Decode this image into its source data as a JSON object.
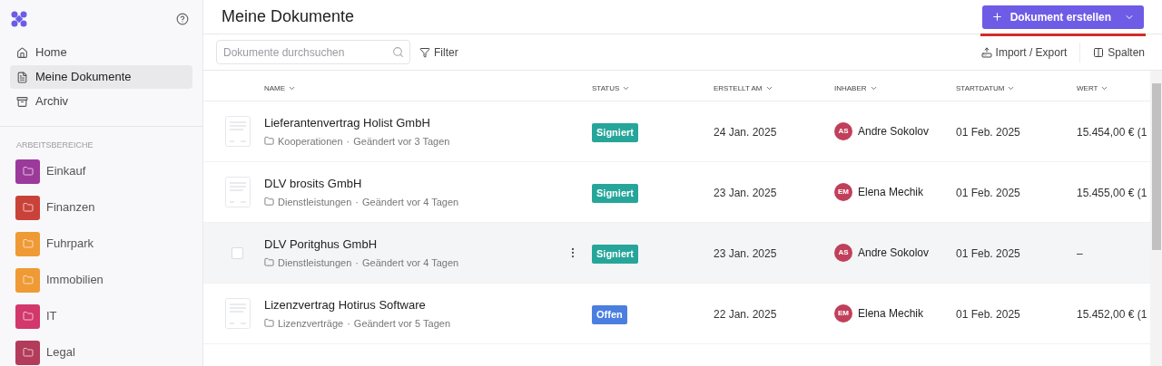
{
  "sidebar": {
    "nav": [
      {
        "label": "Home",
        "selected": false
      },
      {
        "label": "Meine Dokumente",
        "selected": true
      },
      {
        "label": "Archiv",
        "selected": false
      }
    ],
    "section_title": "ARBEITSBEREICHE",
    "workspaces": [
      {
        "label": "Einkauf",
        "color": "#9b3a9b"
      },
      {
        "label": "Finanzen",
        "color": "#c9423a"
      },
      {
        "label": "Fuhrpark",
        "color": "#ef9a35"
      },
      {
        "label": "Immobilien",
        "color": "#ef9a35"
      },
      {
        "label": "IT",
        "color": "#d2386b"
      },
      {
        "label": "Legal",
        "color": "#b23c5a"
      }
    ]
  },
  "page_title": "Meine Dokumente",
  "create_button": "Dokument erstellen",
  "toolbar": {
    "search_placeholder": "Dokumente durchsuchen",
    "filter": "Filter",
    "import_export": "Import / Export",
    "columns": "Spalten"
  },
  "table": {
    "columns": [
      "NAME",
      "STATUS",
      "ERSTELLT AM",
      "INHABER",
      "STARTDATUM",
      "WERT"
    ],
    "rows": [
      {
        "name": "Lieferantenvertrag Holist GmbH",
        "folder": "Kooperationen",
        "separator": "·",
        "changed": "Geändert vor 3 Tagen",
        "status": {
          "label": "Signiert",
          "color": "#26a69a"
        },
        "created": "24 Jan. 2025",
        "owner_initials": "AS",
        "owner": "Andre Sokolov",
        "start": "01 Feb. 2025",
        "value": "15.454,00 € (1",
        "hovered": false
      },
      {
        "name": "DLV brosits GmbH",
        "folder": "Dienstleistungen",
        "separator": "·",
        "changed": "Geändert vor 4 Tagen",
        "status": {
          "label": "Signiert",
          "color": "#26a69a"
        },
        "created": "23 Jan. 2025",
        "owner_initials": "EM",
        "owner": "Elena Mechik",
        "start": "01 Feb. 2025",
        "value": "15.455,00 € (1",
        "hovered": false
      },
      {
        "name": "DLV Poritghus GmbH",
        "folder": "Dienstleistungen",
        "separator": "·",
        "changed": "Geändert vor 4 Tagen",
        "status": {
          "label": "Signiert",
          "color": "#26a69a"
        },
        "created": "23 Jan. 2025",
        "owner_initials": "AS",
        "owner": "Andre Sokolov",
        "start": "01 Feb. 2025",
        "value": "–",
        "hovered": true
      },
      {
        "name": "Lizenzvertrag Hotirus Software",
        "folder": "Lizenzverträge",
        "separator": "·",
        "changed": "Geändert vor 5 Tagen",
        "status": {
          "label": "Offen",
          "color": "#4a7fe0"
        },
        "created": "22 Jan. 2025",
        "owner_initials": "EM",
        "owner": "Elena Mechik",
        "start": "01 Feb. 2025",
        "value": "15.452,00 € (1",
        "hovered": false
      }
    ]
  }
}
